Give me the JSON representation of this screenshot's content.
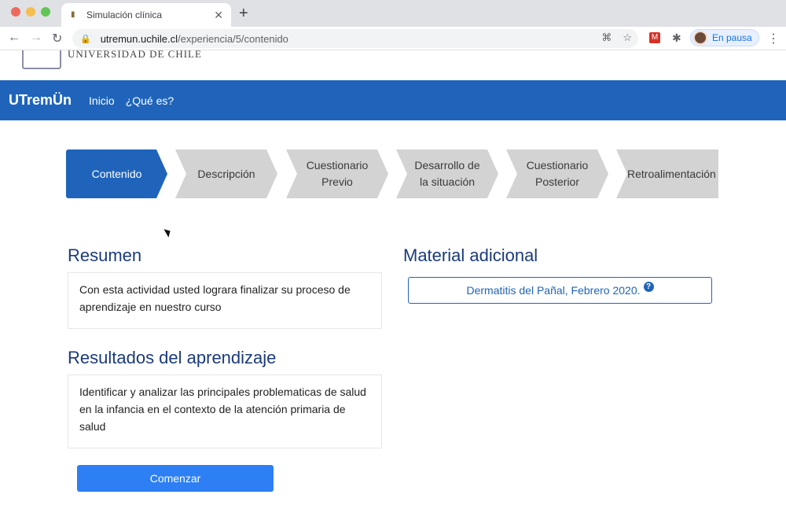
{
  "browser": {
    "tab_title": "Simulación clínica",
    "url_host": "utremun.uchile.cl",
    "url_path": "/experiencia/5/contenido",
    "profile_label": "En pausa",
    "ext_label": "M"
  },
  "site": {
    "university_name": "UNIVERSIDAD DE CHILE",
    "brand": "UTremÜn",
    "nav": [
      "Inicio",
      "¿Qué es?"
    ]
  },
  "steps": [
    {
      "label": "Contenido",
      "active": true
    },
    {
      "label": "Descripción",
      "active": false
    },
    {
      "label": "Cuestionario Previo",
      "active": false
    },
    {
      "label": "Desarrollo de la situación",
      "active": false
    },
    {
      "label": "Cuestionario Posterior",
      "active": false
    },
    {
      "label": "Retroalimentación",
      "active": false
    }
  ],
  "resumen": {
    "title": "Resumen",
    "text": "Con esta actividad usted lograra finalizar su proceso de aprendizaje en nuestro curso"
  },
  "resultados": {
    "title": "Resultados del aprendizaje",
    "text": "Identificar y analizar las principales problematicas de salud en la infancia en el contexto de la atención primaria de salud"
  },
  "material": {
    "title": "Material adicional",
    "link_label": "Dermatitis del Pañal, Febrero 2020."
  },
  "actions": {
    "start_label": "Comenzar"
  },
  "colors": {
    "primary": "#1f64ba",
    "button": "#2d7ff3",
    "step_inactive": "#d3d3d3",
    "heading": "#1b3a7a"
  }
}
